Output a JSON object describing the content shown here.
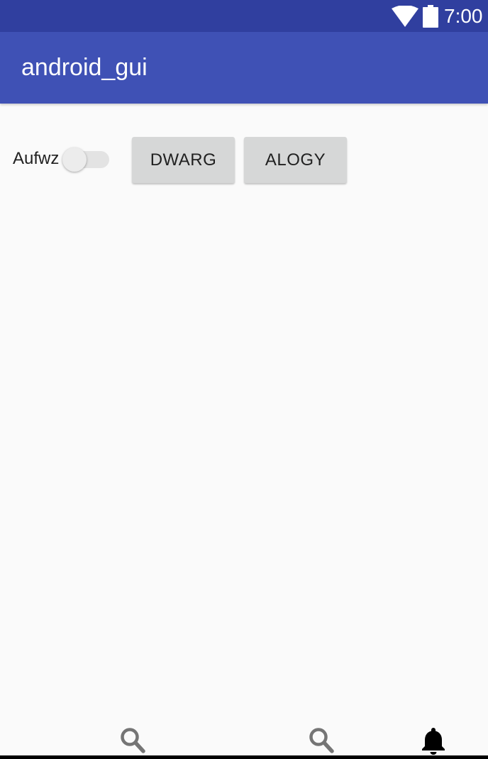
{
  "status_bar": {
    "time": "7:00",
    "icons": [
      "wifi-icon",
      "battery-icon"
    ]
  },
  "app_bar": {
    "title": "android_gui"
  },
  "content": {
    "switch": {
      "label": "Aufwz",
      "checked": false
    },
    "buttons": [
      {
        "label": "DWARG"
      },
      {
        "label": "ALOGY"
      }
    ]
  },
  "bottom_nav": {
    "items": [
      {
        "icon": "search-icon"
      },
      {
        "icon": "search-icon"
      },
      {
        "icon": "bell-icon"
      }
    ]
  },
  "colors": {
    "status_bar": "#303f9f",
    "app_bar": "#3f51b5",
    "background": "#fafafa",
    "button": "#d6d7d7"
  }
}
